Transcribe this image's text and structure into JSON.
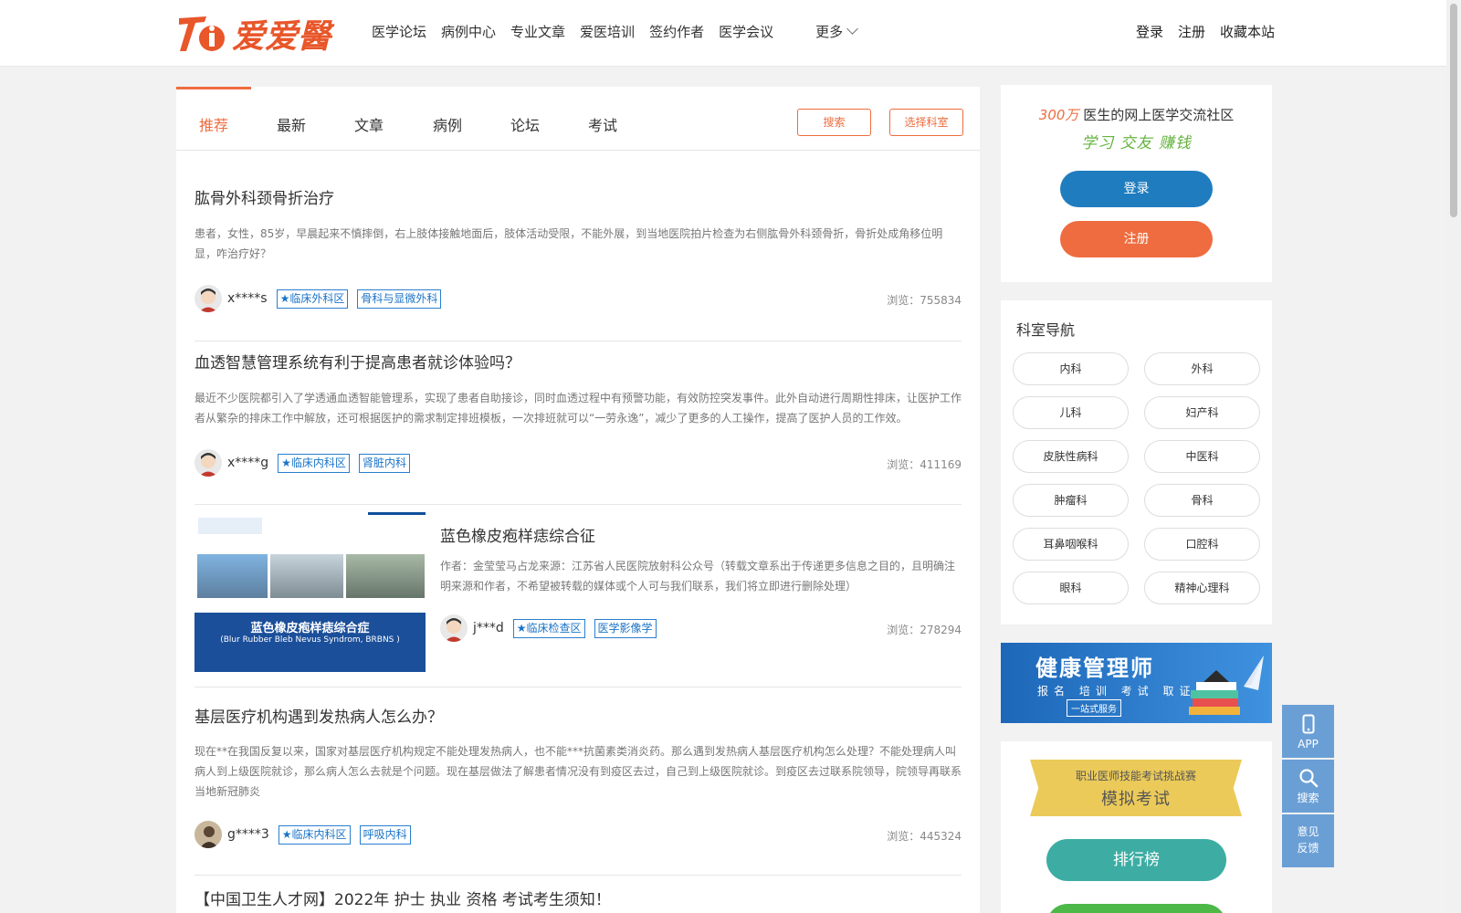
{
  "header": {
    "logo_text": "爱爱醫",
    "nav": [
      "医学论坛",
      "病例中心",
      "专业文章",
      "爱医培训",
      "签约作者",
      "医学会议"
    ],
    "more_label": "更多",
    "user_links": [
      "登录",
      "注册",
      "收藏本站"
    ]
  },
  "tabs": {
    "items": [
      "推荐",
      "最新",
      "文章",
      "病例",
      "论坛",
      "考试"
    ],
    "active": "推荐",
    "search_label": "搜索",
    "select_dept_label": "选择科室"
  },
  "posts": [
    {
      "title": "肱骨外科颈骨折治疗",
      "excerpt": "患者，女性，85岁，早晨起来不慎摔倒，右上肢体接触地面后，肢体活动受限，不能外展，到当地医院拍片检查为右侧肱骨外科颈骨折，骨折处成角移位明显，咋治疗好？",
      "author": "x****s",
      "tags": [
        "★临床外科区",
        "骨科与显微外科"
      ],
      "views": "浏览：755834"
    },
    {
      "title": "血透智慧管理系统有利于提高患者就诊体验吗？",
      "excerpt": "最近不少医院都引入了学透通血透智能管理系，实现了患者自助接诊，同时血透过程中有预警功能，有效防控突发事件。此外自动进行周期性排床，让医护工作者从繁杂的排床工作中解放，还可根据医护的需求制定排班模板，一次排班就可以“一劳永逸”，减少了更多的人工操作，提高了医护人员的工作效。",
      "author": "x****g",
      "tags": [
        "★临床内科区",
        "肾脏内科"
      ],
      "views": "浏览：411169"
    },
    {
      "title": "蓝色橡皮疱样痣综合征",
      "excerpt": "作者：金莹莹马占龙来源：江苏省人民医院放射科公众号（转载文章系出于传递更多信息之目的，且明确注明来源和作者，不希望被转载的媒体或个人可与我们联系，我们将立即进行删除处理）",
      "author": "j***d",
      "tags": [
        "★临床检查区",
        "医学影像学"
      ],
      "views": "浏览：278294",
      "thumb_title": "蓝色橡皮疱样痣综合症",
      "thumb_subtitle": "(Blur Rubber Bleb Nevus Syndrom, BRBNS )"
    },
    {
      "title": "基层医疗机构遇到发热病人怎么办？",
      "excerpt": "现在**在我国反复以来，国家对基层医疗机构规定不能处理发热病人，也不能***抗菌素类消炎药。那么遇到发热病人基层医疗机构怎么处理？不能处理病人叫病人到上级医院就诊，那么病人怎么去就是个问题。现在基层做法了解患者情况没有到疫区去过，自己到上级医院就诊。到疫区去过联系院领导，院领导再联系当地新冠肺炎",
      "author": "g****3",
      "tags": [
        "★临床内科区",
        "呼吸内科"
      ],
      "views": "浏览：445324"
    },
    {
      "title": "【中国卫生人才网】2022年 护士 执业 资格 考试考生须知！"
    }
  ],
  "sidebar": {
    "promo": {
      "highlight": "300万",
      "line1_rest": " 医生的网上医学交流社区",
      "line2": "学习 交友 赚钱",
      "login": "登录",
      "register": "注册"
    },
    "dept_title": "科室导航",
    "depts": [
      "内科",
      "外科",
      "儿科",
      "妇产科",
      "皮肤性病科",
      "中医科",
      "肿瘤科",
      "骨科",
      "耳鼻咽喉科",
      "口腔科",
      "眼科",
      "精神心理科"
    ],
    "banner": {
      "title": "健康管理师",
      "subtitle": "报名 培训 考试 取证",
      "box": "一站式服务"
    },
    "exam": {
      "ribbon_top": "职业医师技能考试挑战赛",
      "ribbon_main": "模拟考试",
      "rank": "排行榜"
    }
  },
  "float_tools": [
    "APP",
    "搜索",
    "意见反馈"
  ],
  "colors": {
    "accent": "#ee6c3f",
    "login_blue": "#1f7dbf",
    "tag_blue": "#1a73c7",
    "float_blue": "#6a9fd6",
    "green": "#64b33e",
    "teal": "#3dada4"
  }
}
